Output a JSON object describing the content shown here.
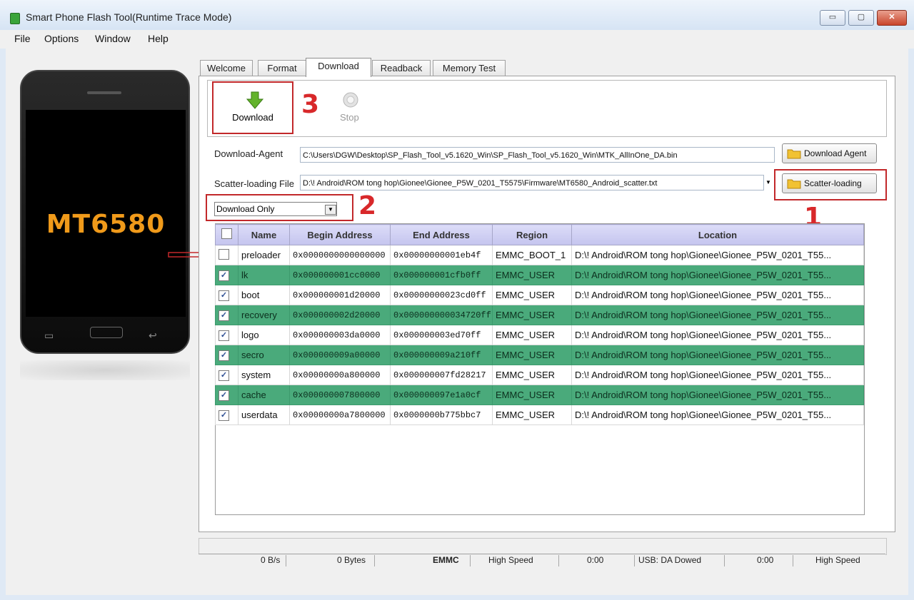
{
  "window": {
    "title": "Smart Phone Flash Tool(Runtime Trace Mode)",
    "min": "▭",
    "max": "▢",
    "close": "✕"
  },
  "menu": [
    "File",
    "Options",
    "Window",
    "Help"
  ],
  "phone": {
    "chip": "MT6580"
  },
  "tabs": [
    "Welcome",
    "Format",
    "Download",
    "Readback",
    "Memory Test"
  ],
  "toolbar": {
    "download_label": "Download",
    "stop_label": "Stop"
  },
  "annotations": {
    "step1": "1",
    "step2": "2",
    "step3": "3"
  },
  "download_agent": {
    "label": "Download-Agent",
    "value": "C:\\Users\\DGW\\Desktop\\SP_Flash_Tool_v5.1620_Win\\SP_Flash_Tool_v5.1620_Win\\MTK_AllInOne_DA.bin",
    "button": "Download Agent"
  },
  "scatter": {
    "label": "Scatter-loading File",
    "value": "D:\\! Android\\ROM tong hop\\Gionee\\Gionee_P5W_0201_T5575\\Firmware\\MT6580_Android_scatter.txt",
    "button": "Scatter-loading"
  },
  "mode_select": {
    "value": "Download Only"
  },
  "table": {
    "headers": [
      "Name",
      "Begin Address",
      "End Address",
      "Region",
      "Location"
    ],
    "rows": [
      {
        "checked": false,
        "name": "preloader",
        "begin": "0x0000000000000000",
        "end": "0x00000000001eb4f",
        "region": "EMMC_BOOT_1",
        "location": "D:\\! Android\\ROM tong hop\\Gionee\\Gionee_P5W_0201_T55..."
      },
      {
        "checked": true,
        "name": "lk",
        "begin": "0x000000001cc0000",
        "end": "0x000000001cfb0ff",
        "region": "EMMC_USER",
        "location": "D:\\! Android\\ROM tong hop\\Gionee\\Gionee_P5W_0201_T55..."
      },
      {
        "checked": true,
        "name": "boot",
        "begin": "0x000000001d20000",
        "end": "0x00000000023cd0ff",
        "region": "EMMC_USER",
        "location": "D:\\! Android\\ROM tong hop\\Gionee\\Gionee_P5W_0201_T55..."
      },
      {
        "checked": true,
        "name": "recovery",
        "begin": "0x000000002d20000",
        "end": "0x000000000034720ff",
        "region": "EMMC_USER",
        "location": "D:\\! Android\\ROM tong hop\\Gionee\\Gionee_P5W_0201_T55..."
      },
      {
        "checked": true,
        "name": "logo",
        "begin": "0x000000003da0000",
        "end": "0x000000003ed70ff",
        "region": "EMMC_USER",
        "location": "D:\\! Android\\ROM tong hop\\Gionee\\Gionee_P5W_0201_T55..."
      },
      {
        "checked": true,
        "name": "secro",
        "begin": "0x000000009a00000",
        "end": "0x000000009a210ff",
        "region": "EMMC_USER",
        "location": "D:\\! Android\\ROM tong hop\\Gionee\\Gionee_P5W_0201_T55..."
      },
      {
        "checked": true,
        "name": "system",
        "begin": "0x00000000a800000",
        "end": "0x000000007fd28217",
        "region": "EMMC_USER",
        "location": "D:\\! Android\\ROM tong hop\\Gionee\\Gionee_P5W_0201_T55..."
      },
      {
        "checked": true,
        "name": "cache",
        "begin": "0x000000007800000",
        "end": "0x000000097e1a0cf",
        "region": "EMMC_USER",
        "location": "D:\\! Android\\ROM tong hop\\Gionee\\Gionee_P5W_0201_T55..."
      },
      {
        "checked": true,
        "name": "userdata",
        "begin": "0x00000000a7800000",
        "end": "0x0000000b775bbc7",
        "region": "EMMC_USER",
        "location": "D:\\! Android\\ROM tong hop\\Gionee\\Gionee_P5W_0201_T55..."
      }
    ]
  },
  "status": {
    "speed": "0 B/s",
    "bytes": "0 Bytes",
    "storage": "EMMC",
    "mode": "High Speed",
    "time1": "0:00",
    "usb": "USB: DA Dowed",
    "time2": "0:00",
    "mode2": "High Speed"
  },
  "colors": {
    "highlight": "#c2282a",
    "row_green": "#4aaa7b",
    "chip_text": "#f09a1a"
  }
}
